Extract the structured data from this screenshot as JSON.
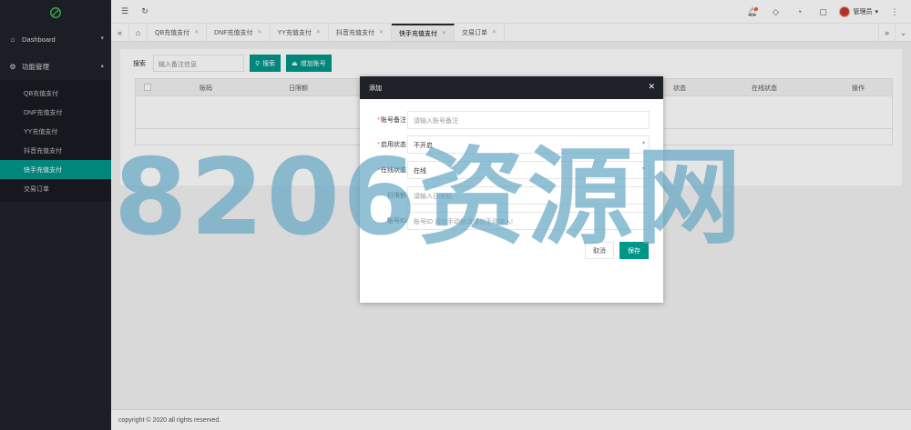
{
  "sidebar": {
    "groups": [
      {
        "label": "Dashboard",
        "chevron": "⌄"
      },
      {
        "label": "功能管理",
        "chevron": "⌃"
      }
    ],
    "items": [
      {
        "label": "QB充值支付"
      },
      {
        "label": "DNF充值支付"
      },
      {
        "label": "YY充值支付"
      },
      {
        "label": "抖音充值支付"
      },
      {
        "label": "快手充值支付",
        "active": true
      },
      {
        "label": "交易订单"
      }
    ]
  },
  "header": {
    "user_name": "管理员",
    "icons": [
      "menu-icon",
      "refresh-icon",
      "bell-icon",
      "tag-icon",
      "theme-icon",
      "note-icon",
      "more-icon"
    ]
  },
  "tabs": [
    {
      "label": "QB充值支付"
    },
    {
      "label": "DNF充值支付"
    },
    {
      "label": "YY充值支付"
    },
    {
      "label": "抖音充值支付"
    },
    {
      "label": "快手充值支付",
      "active": true
    },
    {
      "label": "交易订单"
    }
  ],
  "search": {
    "label": "搜索",
    "placeholder": "输入备注信息",
    "search_button": "搜索",
    "add_button": "增加账号"
  },
  "table": {
    "columns": [
      "账码",
      "日限额",
      "状态",
      "在线状态",
      "操作"
    ]
  },
  "modal": {
    "title": "添加",
    "fields": [
      {
        "label": "账号备注",
        "required": true,
        "placeholder": "请输入账号备注",
        "value": ""
      },
      {
        "label": "启用状态",
        "required": true,
        "value": "不开启",
        "select": true
      },
      {
        "label": "在线状态",
        "required": true,
        "value": "在线",
        "select": true
      },
      {
        "label": "日限额",
        "required": false,
        "placeholder": "请输入日限额",
        "value": ""
      },
      {
        "label": "账号ID",
        "required": false,
        "placeholder": "账号ID 请勿手动修改请勿手动输入!",
        "value": ""
      }
    ],
    "cancel": "取消",
    "save": "保存"
  },
  "footer": {
    "copyright": "copyright © 2020 all rights reserved."
  },
  "watermark": "8206资源网",
  "colors": {
    "sidebar_bg": "#20222a",
    "accent": "#009688",
    "danger": "#ff5722"
  }
}
